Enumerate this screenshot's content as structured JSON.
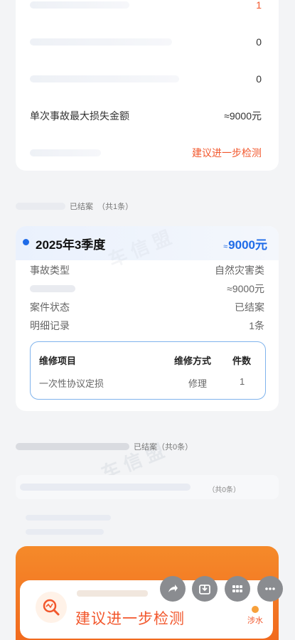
{
  "summary": {
    "rows": [
      {
        "value": "1",
        "value_color": "#f2572c"
      },
      {
        "value": "0"
      },
      {
        "value": "0"
      }
    ],
    "max_loss_label": "单次事故最大损失金额",
    "max_loss_value": "≈9000元",
    "suggest_link": "建议进一步检测"
  },
  "closed_section": {
    "status": "已结案",
    "count": "（共1条）"
  },
  "claim": {
    "title": "2025年3季度",
    "amount": "9000元",
    "approx": "≈",
    "fields": [
      {
        "label": "事故类型",
        "value": "自然灾害类"
      },
      {
        "label": "",
        "value": "≈9000元"
      },
      {
        "label": "案件状态",
        "value": "已结案"
      },
      {
        "label": "明细记录",
        "value": "1条"
      }
    ],
    "repair_table": {
      "headers": [
        "维修项目",
        "维修方式",
        "件数"
      ],
      "rows": [
        [
          "一次性协议定损",
          "修理",
          "1"
        ]
      ]
    }
  },
  "second_section": {
    "status": "已结案（共0条）",
    "count": "（共0条）"
  },
  "cta": {
    "label": "建议进一步检测",
    "tag": "涉水"
  },
  "fab_icons": [
    "share-icon",
    "download-icon",
    "grid-icon",
    "more-icon"
  ],
  "colors": {
    "accent_orange": "#f2572c",
    "accent_blue": "#1e6be8"
  }
}
